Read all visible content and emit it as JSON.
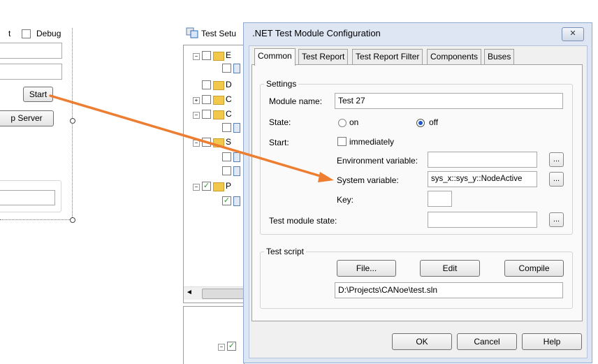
{
  "left_panel": {
    "partial_label": "t",
    "debug_label": "Debug",
    "start_button": "Start",
    "server_button": "p Server"
  },
  "middle_panel": {
    "title": "Test Setu",
    "tree_letters": [
      "E",
      "D",
      "C",
      "C",
      "S",
      "P"
    ]
  },
  "dialog": {
    "title": ".NET Test Module Configuration",
    "close_glyph": "✕",
    "tabs": [
      "Common",
      "Test Report",
      "Test Report Filter",
      "Components",
      "Buses"
    ],
    "settings": {
      "group_title": "Settings",
      "module_name_label": "Module name:",
      "module_name_value": "Test 27",
      "state_label": "State:",
      "state_on": "on",
      "state_off": "off",
      "state_selected": "off",
      "start_label": "Start:",
      "immediately_label": "immediately",
      "env_var_label": "Environment variable:",
      "env_var_value": "",
      "sys_var_label": "System variable:",
      "sys_var_value": "sys_x::sys_y::NodeActive",
      "key_label": "Key:",
      "key_value": "",
      "module_state_label": "Test module state:",
      "module_state_value": "",
      "browse_label": "..."
    },
    "test_script": {
      "group_title": "Test script",
      "file_button": "File...",
      "edit_button": "Edit",
      "compile_button": "Compile",
      "path_value": "D:\\Projects\\CANoe\\test.sln"
    },
    "footer": {
      "ok": "OK",
      "cancel": "Cancel",
      "help": "Help"
    }
  },
  "colors": {
    "arrow": "#ed7d31",
    "dialog_border": "#8faad0",
    "dialog_bg": "#e9eef6",
    "radio_selected": "#1f56c9"
  }
}
